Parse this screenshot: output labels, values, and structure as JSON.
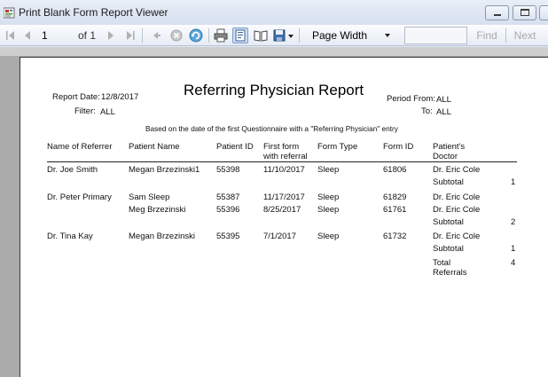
{
  "window": {
    "title": "Print Blank Form Report Viewer"
  },
  "toolbar": {
    "page_current": "1",
    "page_of": "of 1",
    "zoom": "Page Width",
    "search_value": "",
    "find_label": "Find",
    "next_label": "Next",
    "icons": [
      "first-page-icon",
      "previous-page-icon",
      "next-page-icon",
      "last-page-icon",
      "back-icon",
      "stop-icon",
      "refresh-icon",
      "print-icon",
      "print-layout-icon",
      "page-setup-icon",
      "export-icon"
    ]
  },
  "report": {
    "title": "Referring Physician Report",
    "report_date_label": "Report Date:",
    "report_date": "12/8/2017",
    "filter_label": "Filter:",
    "filter": "ALL",
    "period_from_label": "Period From:",
    "period_from": "ALL",
    "to_label": "To:",
    "to": "ALL",
    "subtitle": "Based on the date of the first Questionnaire with a \"Referring Physician\" entry",
    "columns": {
      "referrer": "Name of Referrer",
      "patient": "Patient Name",
      "patient_id": "Patient ID",
      "first_form_1": "First form",
      "first_form_2": "with referral",
      "form_type": "Form Type",
      "form_id": "Form ID",
      "doctor_1": "Patient's",
      "doctor_2": "Doctor"
    },
    "rows": [
      {
        "referrer": "Dr. Joe Smith",
        "patient": "Megan Brzezinski1",
        "patient_id": "55398",
        "first_form": "11/10/2017",
        "form_type": "Sleep",
        "form_id": "61806",
        "doctor": "Dr. Eric Cole"
      },
      {
        "referrer": "Dr. Peter Primary",
        "patient": "Sam Sleep",
        "patient_id": "55387",
        "first_form": "11/17/2017",
        "form_type": "Sleep",
        "form_id": "61829",
        "doctor": "Dr. Eric Cole"
      },
      {
        "referrer": "",
        "patient": "Meg Brzezinski",
        "patient_id": "55396",
        "first_form": "8/25/2017",
        "form_type": "Sleep",
        "form_id": "61761",
        "doctor": "Dr. Eric Cole"
      },
      {
        "referrer": "Dr. Tina Kay",
        "patient": "Megan Brzezinski",
        "patient_id": "55395",
        "first_form": "7/1/2017",
        "form_type": "Sleep",
        "form_id": "61732",
        "doctor": "Dr. Eric Cole"
      }
    ],
    "subtotals": [
      {
        "label": "Subtotal",
        "value": "1"
      },
      {
        "label": "Subtotal",
        "value": "2"
      },
      {
        "label": "Subtotal",
        "value": "1"
      }
    ],
    "total_label_1": "Total",
    "total_label_2": "Referrals",
    "total_value": "4"
  }
}
